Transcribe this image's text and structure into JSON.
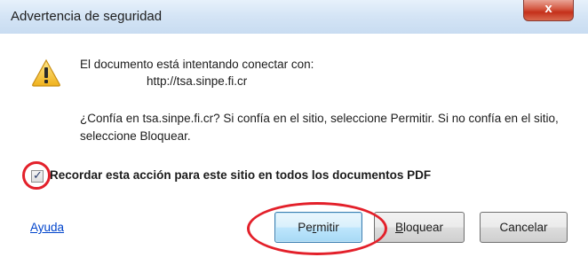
{
  "window": {
    "title": "Advertencia de seguridad",
    "close_label": "x"
  },
  "message": {
    "intro": "El documento está intentando conectar con:",
    "url": "http://tsa.sinpe.fi.cr",
    "question": "¿Confía en tsa.sinpe.fi.cr? Si confía en el sitio, seleccione Permitir. Si no confía en el sitio, seleccione Bloquear."
  },
  "remember": {
    "label": "Recordar esta acción para este sitio en todos los documentos PDF",
    "checked": true
  },
  "buttons": {
    "help": "Ayuda",
    "allow_pre": "Pe",
    "allow_ul": "r",
    "allow_post": "mitir",
    "block_ul": "B",
    "block_post": "loquear",
    "cancel": "Cancelar"
  },
  "icons": {
    "warning": "warning-triangle-icon",
    "close": "close-icon",
    "check": "check-icon"
  },
  "colors": {
    "highlight": "#e3202a",
    "link": "#0044cc",
    "warning_fill": "#f6c233"
  }
}
